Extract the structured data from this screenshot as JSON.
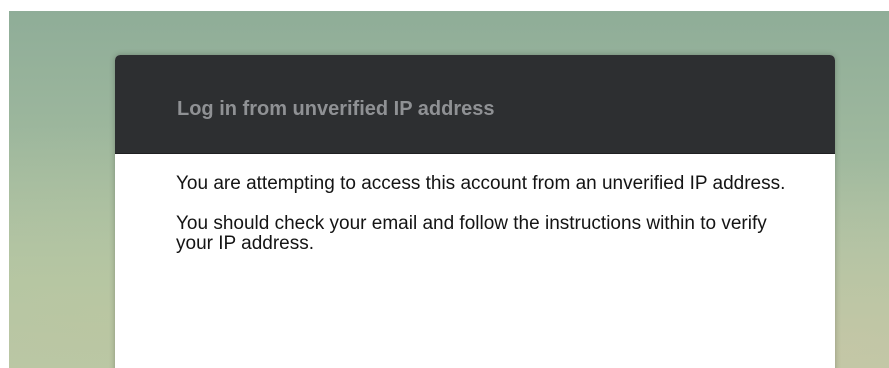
{
  "dialog": {
    "title": "Log in from unverified IP address",
    "paragraphs": [
      "You are attempting to access this account from an unverified IP address.",
      "You should check your email and follow the instructions within to verify your IP address."
    ]
  },
  "colors": {
    "header_background": "#2d2f31",
    "title_text": "#8f9194",
    "body_text": "#141414",
    "backdrop": "#9db79d"
  }
}
